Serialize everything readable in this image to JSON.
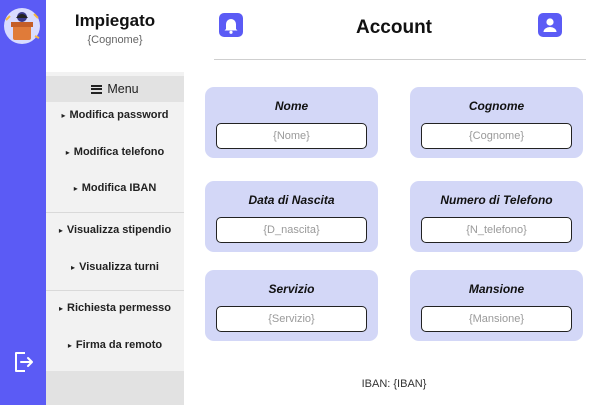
{
  "sidebar": {
    "title": "Impiegato",
    "subtitle": "{Cognome}",
    "menu_label": "Menu",
    "items": [
      {
        "label": "Modifica password"
      },
      {
        "label": "Modifica telefono"
      },
      {
        "label": "Modifica IBAN"
      },
      {
        "label": "Visualizza stipendio"
      },
      {
        "label": "Visualizza turni"
      },
      {
        "label": "Richiesta permesso"
      },
      {
        "label": "Firma da remoto"
      }
    ]
  },
  "header": {
    "title": "Account"
  },
  "fields": [
    {
      "label": "Nome",
      "value": "{Nome}"
    },
    {
      "label": "Cognome",
      "value": "{Cognome}"
    },
    {
      "label": "Data di Nascita",
      "value": "{D_nascita}"
    },
    {
      "label": "Numero di Telefono",
      "value": "{N_telefono}"
    },
    {
      "label": "Servizio",
      "value": "{Servizio}"
    },
    {
      "label": "Mansione",
      "value": "{Mansione}"
    }
  ],
  "iban": "IBAN: {IBAN}",
  "icons": {
    "logo": "employee-logo-icon",
    "exit": "logout-icon",
    "bell": "bell-icon",
    "user": "user-icon",
    "menu": "hamburger-icon"
  },
  "colors": {
    "accent": "#5b5bf5",
    "card": "#d3d7f7"
  }
}
